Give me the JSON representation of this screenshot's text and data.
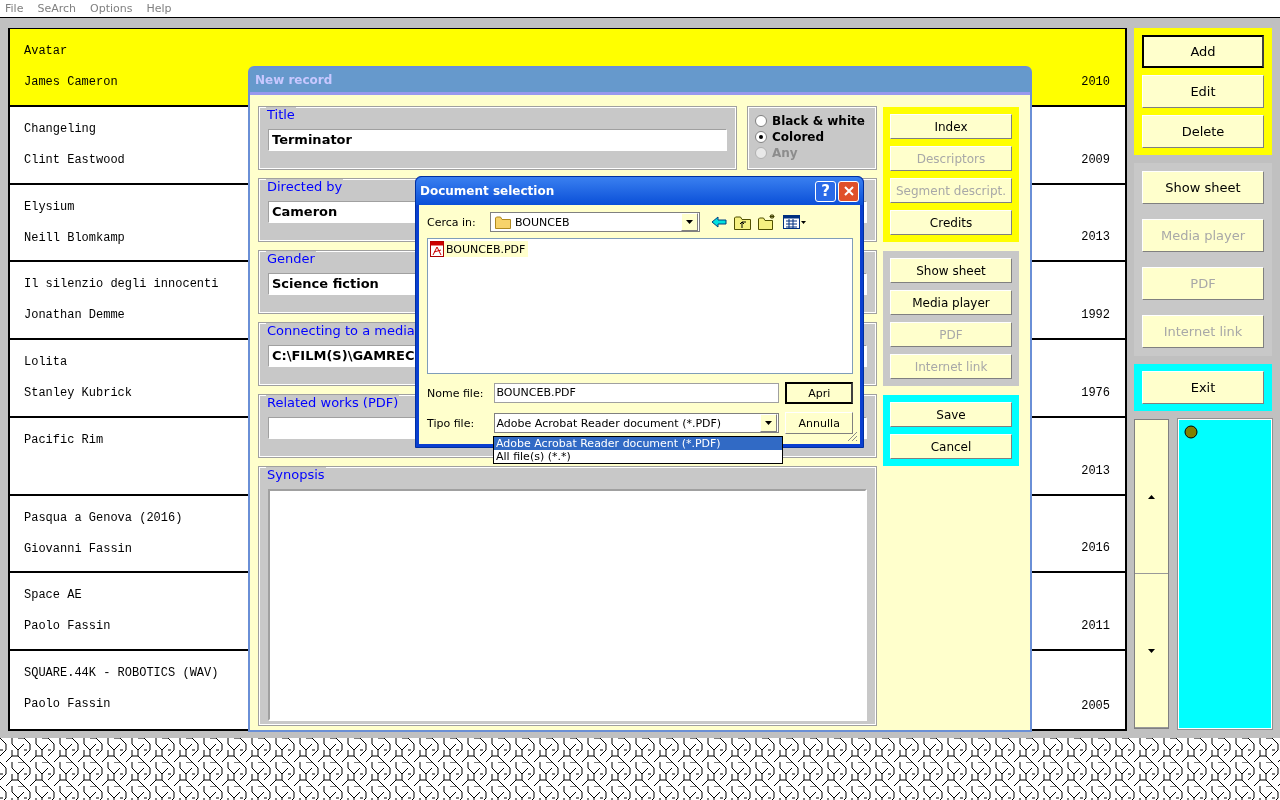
{
  "menu": [
    {
      "label": "File"
    },
    {
      "label": "SeArch"
    },
    {
      "label": "Options"
    },
    {
      "label": "Help"
    }
  ],
  "records": [
    {
      "title": "Avatar",
      "director": "James Cameron",
      "year": "2010",
      "selected": true
    },
    {
      "title": "Changeling",
      "director": "Clint Eastwood",
      "year": "2009",
      "selected": false
    },
    {
      "title": "Elysium",
      "director": "Neill Blomkamp",
      "year": "2013",
      "selected": false
    },
    {
      "title": "Il silenzio degli innocenti",
      "director": "Jonathan Demme",
      "year": "1992",
      "selected": false
    },
    {
      "title": "Lolita",
      "director": "Stanley Kubrick",
      "year": "1976",
      "selected": false
    },
    {
      "title": "Pacific Rim",
      "year": "2013",
      "selected": false
    },
    {
      "title": "Pasqua a Genova (2016)",
      "director": "Giovanni Fassin",
      "year": "2016",
      "selected": false
    },
    {
      "title": "Space AE",
      "director": "Paolo Fassin",
      "year": "2011",
      "selected": false
    },
    {
      "title": "SQUARE.44K - ROBOTICS (WAV)",
      "director": "Paolo Fassin",
      "year": "2005",
      "selected": false
    }
  ],
  "side_groups": [
    {
      "color": "#ffff00",
      "buttons": [
        {
          "label": "Add",
          "default": true,
          "disabled": false
        },
        {
          "label": "Edit",
          "default": false,
          "disabled": false
        },
        {
          "label": "Delete",
          "default": false,
          "disabled": false
        }
      ]
    },
    {
      "color": "#c8c8c8",
      "buttons": [
        {
          "label": "Show sheet",
          "default": false,
          "disabled": false
        },
        {
          "label": "Media player",
          "default": false,
          "disabled": true
        },
        {
          "label": "PDF",
          "default": false,
          "disabled": true
        },
        {
          "label": "Internet link",
          "default": false,
          "disabled": true
        }
      ]
    },
    {
      "color": "#00ffff",
      "buttons": [
        {
          "label": "Exit",
          "default": false,
          "disabled": false
        }
      ]
    }
  ],
  "new_record": {
    "title": "New record",
    "title_field": {
      "label": "Title",
      "value": "Terminator"
    },
    "color_options": [
      {
        "label": "Black & white",
        "selected": false,
        "disabled": false
      },
      {
        "label": "Colored",
        "selected": true,
        "disabled": false
      },
      {
        "label": "Any",
        "selected": false,
        "disabled": true
      }
    ],
    "fields": [
      {
        "kind": "text",
        "label": "Directed by",
        "value": "Cameron"
      },
      {
        "kind": "text",
        "label": "Gender",
        "value": "Science fiction"
      },
      {
        "kind": "text",
        "label": "Connecting to a media",
        "value": "C:\\FILM(S)\\GAMREC"
      },
      {
        "kind": "text",
        "label": "Related works (PDF)"
      },
      {
        "kind": "textarea",
        "label": "Synopsis"
      }
    ],
    "button_groups": [
      {
        "color": "#ffff00",
        "buttons": [
          {
            "label": "Index",
            "disabled": false
          },
          {
            "label": "Descriptors",
            "disabled": true
          },
          {
            "label": "Segment descript.",
            "disabled": true
          },
          {
            "label": "Credits",
            "disabled": false
          }
        ]
      },
      {
        "color": "#c8c8c8",
        "buttons": [
          {
            "label": "Show sheet",
            "disabled": false
          },
          {
            "label": "Media player",
            "disabled": false
          },
          {
            "label": "PDF",
            "disabled": true
          },
          {
            "label": "Internet link",
            "disabled": true
          }
        ]
      },
      {
        "color": "#00ffff",
        "buttons": [
          {
            "label": "Save",
            "disabled": false
          },
          {
            "label": "Cancel",
            "disabled": false
          }
        ]
      }
    ]
  },
  "document_dialog": {
    "title": "Document selection",
    "help_label": "?",
    "look_in": {
      "label": "Cerca in:",
      "value": "BOUNCEB"
    },
    "files": [
      {
        "name": "BOUNCEB.PDF",
        "selected": true
      }
    ],
    "file_name": {
      "label": "Nome file:",
      "value": "BOUNCEB.PDF"
    },
    "file_type": {
      "label": "Tipo file:",
      "value": "Adobe Acrobat Reader document (*.PDF)"
    },
    "file_type_options": [
      {
        "label": "Adobe Acrobat Reader document (*.PDF)",
        "selected": true
      },
      {
        "label": "All file(s) (*.*)",
        "selected": false
      }
    ],
    "buttons": [
      {
        "label": "Apri",
        "default": true
      },
      {
        "label": "Annulla",
        "default": false
      }
    ]
  }
}
